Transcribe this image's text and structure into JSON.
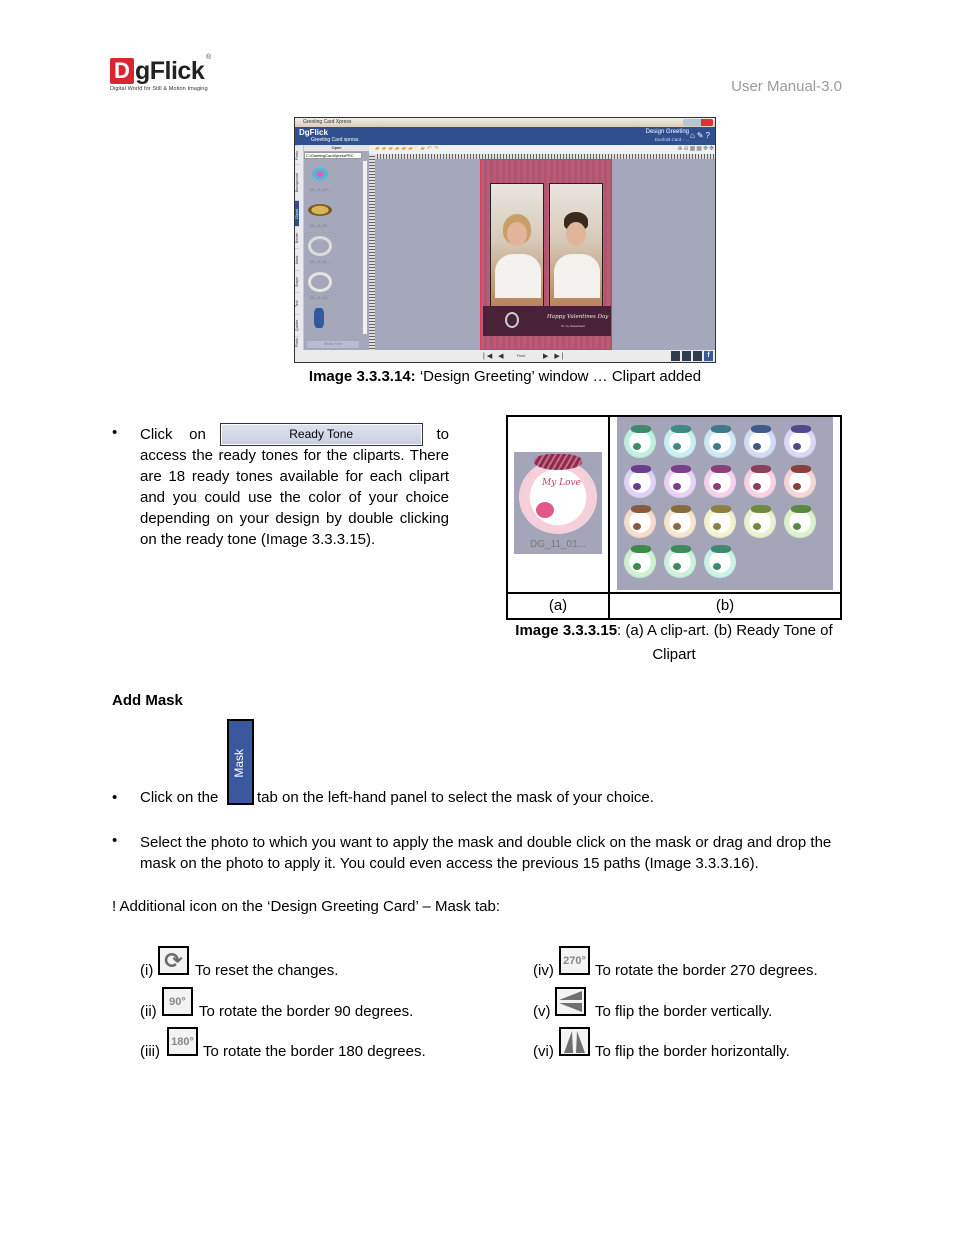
{
  "header": {
    "logo_letter": "D",
    "logo_text": "gFlick",
    "logo_registered": "®",
    "logo_tagline": "Digital World for Still & Motion Imaging",
    "manual_label": "User Manual-3.0"
  },
  "screenshot1": {
    "window_title": "Greeting Card Xpress",
    "brand": "DgFlick",
    "product": "Greeting Card xpress",
    "mode_title": "Design Greeting",
    "mode_subtitle": "Duofold Card - ...",
    "header_icons": [
      "home-icon",
      "wrench-icon",
      "help-icon"
    ],
    "open_label": "Open",
    "path_value": "C:\\GreetingCardXpressPRC",
    "side_tabs": [
      "Photo",
      "Background",
      "Clipart",
      "Border",
      "Mask",
      "Shape",
      "Text",
      "Quotes",
      "Photo"
    ],
    "active_tab": "Clipart",
    "thumbnails": [
      {
        "caption": "DG_11_03..."
      },
      {
        "caption": "DG_11_02..."
      },
      {
        "caption": "DG_11_01..."
      },
      {
        "caption": "DG_11_04..."
      },
      {
        "caption": ""
      }
    ],
    "ready_tone_label": "Ready Tone",
    "card_text": "Happy Valentines Day",
    "card_subtext": "To my Sweetheart",
    "page_label": "Front",
    "nav_first": "|◀",
    "nav_prev": "◀",
    "nav_next": "▶",
    "nav_last": "▶|",
    "facebook_label": "f"
  },
  "caption1": {
    "bold": "Image 3.3.3.14:",
    "text": " ‘Design Greeting’ window … Clipart added"
  },
  "ready_tone_section": {
    "bullet": "•",
    "click_on": "Click    on",
    "button_label": "Ready Tone",
    "to": "to",
    "body": "access the ready tones for the cliparts. There are 18 ready tones available for each clipart and you could use the color of your choice depending on your design by double clicking on the ready tone (Image 3.3.3.15)."
  },
  "figure_table": {
    "clipart_label": "DG_11_01...",
    "clipart_text": "My Love",
    "ready_tone_count": 18,
    "tone_colors": [
      "#bff0de",
      "#c8f0ee",
      "#cde8f2",
      "#d2dcf4",
      "#dcd8f4",
      "#e0d2f4",
      "#ead2f4",
      "#f4d2ee",
      "#f6d2e2",
      "#f6d6d6",
      "#f6dccc",
      "#f6e6cc",
      "#f4f2cc",
      "#e8f2cc",
      "#dcf2cc",
      "#ccf2d2",
      "#ccf2dc",
      "#ccf2e8"
    ],
    "bow_colors": [
      "#3f8a6a",
      "#3f8a84",
      "#3f7a8a",
      "#3f5a8a",
      "#4f4a8a",
      "#6a3f8a",
      "#7a3f8a",
      "#8a3f7a",
      "#8a3f5a",
      "#8a3f3f",
      "#8a5a3f",
      "#8a6a3f",
      "#8a803f",
      "#6e8a3f",
      "#5a8a3f",
      "#3f8a4a",
      "#3f8a5a",
      "#3f8a6e"
    ],
    "col_a": "(a)",
    "col_b": "(b)"
  },
  "caption2": {
    "bold": "Image 3.3.3.15",
    "text": ": (a) A clip-art. (b) Ready Tone of Clipart"
  },
  "mask_section": {
    "heading": "Add Mask",
    "mask_tab_label": "Mask",
    "bullet1_pre": "Click on the",
    "bullet1_post": "tab on the left-hand panel to select the mask of your choice.",
    "bullet2": "Select the photo to which you want to apply the mask and double click on the mask or drag and drop the mask on the photo to apply it. You could even access the previous 15 paths (Image 3.3.3.16).",
    "additional": "! Additional icon on the ‘Design Greeting Card’ – Mask tab:"
  },
  "icons": [
    {
      "num": "(i)",
      "icon": "reset-icon",
      "glyph": "⟳",
      "text": "To reset the changes."
    },
    {
      "num": "(ii)",
      "icon": "rotate-90-icon",
      "glyph": "90°",
      "text": "To rotate the border 90 degrees."
    },
    {
      "num": "(iii)",
      "icon": "rotate-180-icon",
      "glyph": "180°",
      "text": "To rotate the border 180 degrees."
    },
    {
      "num": "(iv)",
      "icon": "rotate-270-icon",
      "glyph": "270°",
      "text": "To rotate the border 270 degrees."
    },
    {
      "num": "(v)",
      "icon": "flip-vertical-icon",
      "glyph": "",
      "text": "To flip the border vertically."
    },
    {
      "num": "(vi)",
      "icon": "flip-horizontal-icon",
      "glyph": "",
      "text": "To flip the border horizontally."
    }
  ]
}
